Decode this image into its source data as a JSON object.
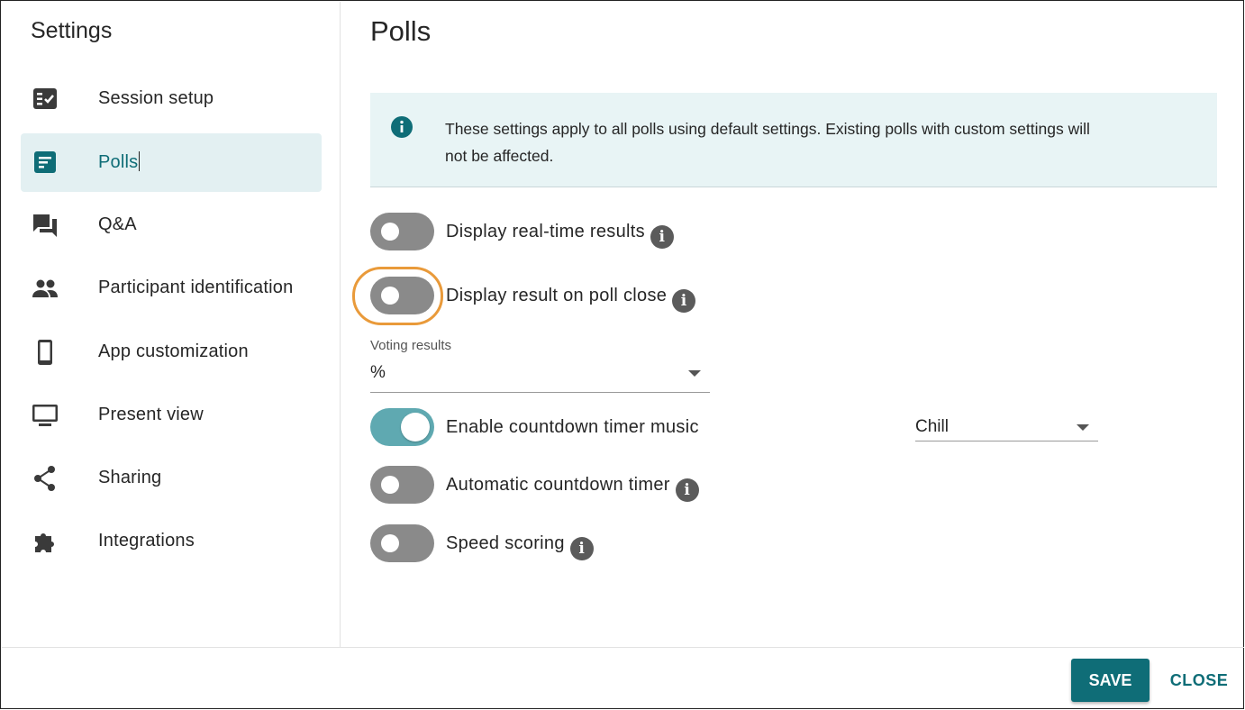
{
  "sidebar": {
    "title": "Settings",
    "items": [
      {
        "label": "Session setup",
        "icon": "checklist-icon",
        "active": false
      },
      {
        "label": "Polls",
        "icon": "poll-document-icon",
        "active": true
      },
      {
        "label": "Q&A",
        "icon": "chat-bubbles-icon",
        "active": false
      },
      {
        "label": "Participant identification",
        "icon": "people-icon",
        "active": false
      },
      {
        "label": "App customization",
        "icon": "phone-icon",
        "active": false
      },
      {
        "label": "Present view",
        "icon": "monitor-icon",
        "active": false
      },
      {
        "label": "Sharing",
        "icon": "share-icon",
        "active": false
      },
      {
        "label": "Integrations",
        "icon": "puzzle-icon",
        "active": false
      }
    ]
  },
  "main": {
    "title": "Polls",
    "info_text": "These settings apply to all polls using default settings. Existing polls with custom settings will not be affected.",
    "toggles": {
      "realtime": {
        "label": "Display real-time results",
        "on": false,
        "help": "i"
      },
      "poll_close": {
        "label": "Display result on poll close",
        "on": false,
        "help": "i"
      },
      "countdown_music": {
        "label": "Enable countdown timer music",
        "on": true
      },
      "auto_countdown": {
        "label": "Automatic countdown timer",
        "on": false,
        "help": "i"
      },
      "speed_scoring": {
        "label": "Speed scoring",
        "on": false,
        "help": "i"
      }
    },
    "voting_results": {
      "label": "Voting results",
      "value": "%"
    },
    "music_select": {
      "value": "Chill"
    }
  },
  "footer": {
    "save_label": "SAVE",
    "close_label": "CLOSE"
  },
  "colors": {
    "accent": "#0f6d77",
    "active_bg": "#e3f0f2",
    "info_bg": "#e8f4f5",
    "toggle_off": "#8a8a8a",
    "toggle_on": "#5fa9b1",
    "highlight": "#e99a3a"
  }
}
